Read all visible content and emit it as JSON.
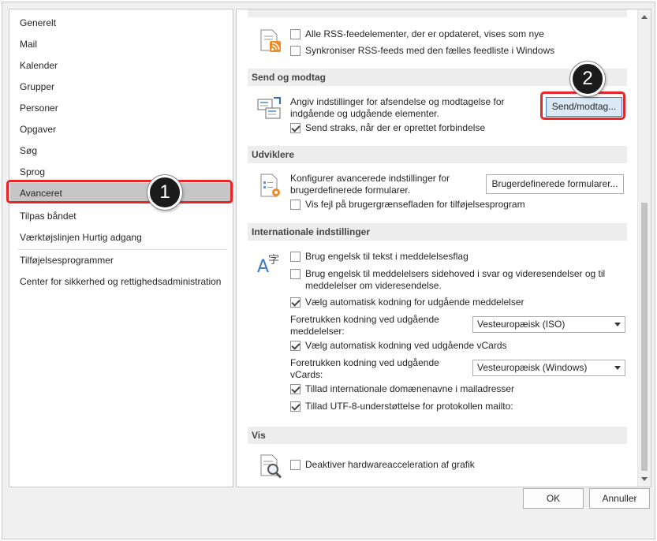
{
  "sidebar": {
    "items": [
      {
        "label": "Generelt"
      },
      {
        "label": "Mail"
      },
      {
        "label": "Kalender"
      },
      {
        "label": "Grupper"
      },
      {
        "label": "Personer"
      },
      {
        "label": "Opgaver"
      },
      {
        "label": "Søg"
      },
      {
        "label": "Sprog"
      },
      {
        "label": "Avanceret",
        "selected": true
      },
      {
        "label": "Tilpas båndet"
      },
      {
        "label": "Værktøjslinjen Hurtig adgang"
      },
      {
        "label": "Tilføjelsesprogrammer"
      },
      {
        "label": "Center for sikkerhed og rettighedsadministration"
      }
    ]
  },
  "rss": {
    "icon": "rss-icon",
    "options": [
      {
        "label": "Alle RSS-feedelementer, der er opdateret, vises som nye",
        "checked": false
      },
      {
        "label": "Synkroniser RSS-feeds med den fælles feedliste i Windows",
        "checked": false
      }
    ]
  },
  "send_receive": {
    "header": "Send og modtag",
    "icon": "send-receive-icon",
    "description": "Angiv indstillinger for afsendelse og modtagelse for indgående og udgående elementer.",
    "button_label": "Send/modtag...",
    "send_immediately": {
      "label": "Send straks, når der er oprettet forbindelse",
      "checked": true
    }
  },
  "developers": {
    "header": "Udviklere",
    "icon": "developer-settings-icon",
    "description": "Konfigurer avancerede indstillinger for brugerdefinerede formularer.",
    "button_label": "Brugerdefinerede formularer...",
    "show_errors": {
      "label": "Vis fejl på brugergrænsefladen for tilføjelsesprogram",
      "checked": false
    }
  },
  "international": {
    "header": "Internationale indstillinger",
    "icon": "language-icon",
    "english_flags": {
      "label": "Brug engelsk til tekst i meddelelsesflag",
      "checked": false
    },
    "english_headers": {
      "label": "Brug engelsk til meddelelsers sidehoved i svar og videresendelser og til meddelelser om videresendelse.",
      "checked": false
    },
    "auto_encoding": {
      "label": "Vælg automatisk kodning for udgående meddelelser",
      "checked": true
    },
    "encoding_label": "Foretrukken kodning ved udgående meddelelser:",
    "encoding_value": "Vesteuropæisk (ISO)",
    "auto_vcard": {
      "label": "Vælg automatisk kodning ved udgående vCards",
      "checked": true
    },
    "vcard_encoding_label": "Foretrukken kodning ved udgående vCards:",
    "vcard_encoding_value": "Vesteuropæisk (Windows)",
    "intl_domains": {
      "label": "Tillad internationale domænenavne i mailadresser",
      "checked": true
    },
    "utf8": {
      "label": "Tillad UTF-8-understøttelse for protokollen mailto:",
      "checked": true
    }
  },
  "display": {
    "header": "Vis",
    "icon": "magnifier-document-icon",
    "hw_accel": {
      "label": "Deaktiver hardwareacceleration af grafik",
      "checked": false
    }
  },
  "footer": {
    "ok_label": "OK",
    "cancel_label": "Annuller"
  },
  "callouts": [
    {
      "number": "1"
    },
    {
      "number": "2"
    }
  ],
  "colors": {
    "highlight": "#e8262a",
    "selected_bg": "#c6c6c6",
    "primary_button": "#dbe9f7"
  }
}
